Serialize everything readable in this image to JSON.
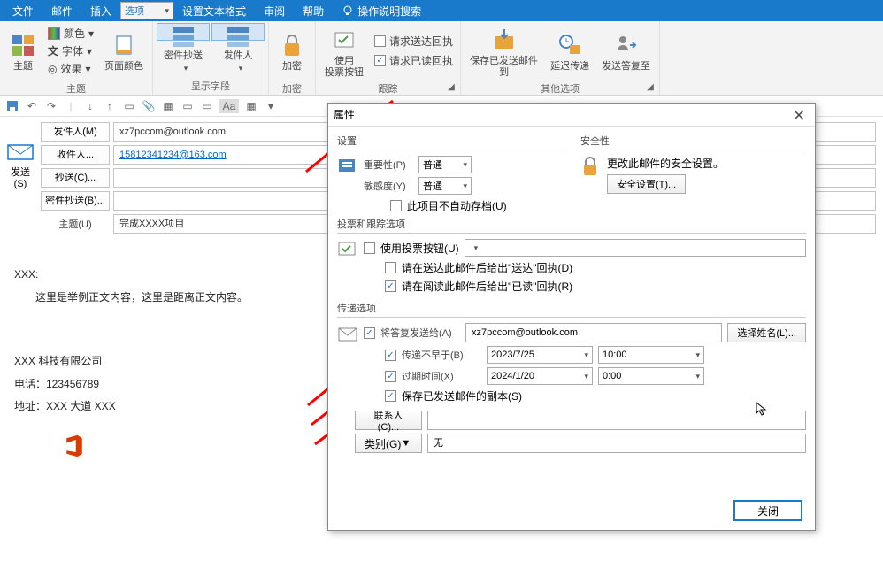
{
  "tabs": [
    "文件",
    "邮件",
    "插入",
    "选项",
    "设置文本格式",
    "审阅",
    "帮助"
  ],
  "tell_me": "操作说明搜索",
  "ribbon": {
    "theme_group": {
      "theme": "主题",
      "color": "颜色",
      "font": "字体",
      "effects": "效果",
      "page_color": "页面颜色",
      "label": "主题"
    },
    "show_group": {
      "bcc": "密件抄送",
      "from": "发件人",
      "label": "显示字段"
    },
    "encrypt_group": {
      "encrypt": "加密",
      "label": "加密"
    },
    "vote_group": {
      "button": "使用\n投票按钮",
      "req_delivery": "请求送达回执",
      "req_read": "请求已读回执",
      "label": "跟踪"
    },
    "more_group": {
      "save_sent": "保存已发送邮件\n到",
      "delay": "延迟传递",
      "direct_reply": "发送答复至",
      "label": "其他选项"
    }
  },
  "compose": {
    "send": "发送\n(S)",
    "from_btn": "发件人(M)",
    "from_val": "xz7pccom@outlook.com",
    "to_btn": "收件人...",
    "to_val": "15812341234@163.com",
    "cc_btn": "抄送(C)...",
    "cc_val": "",
    "bcc_btn": "密件抄送(B)...",
    "bcc_val": "",
    "subj_lbl": "主题(U)",
    "subj_val": "完成XXXX项目"
  },
  "body": {
    "greet": "XXX:",
    "para": "这里是举例正文内容，这里是距离正文内容。",
    "sig1": "XXX 科技有限公司",
    "sig2": "电话：123456789",
    "sig3": "地址：XXX 大道 XXX"
  },
  "dialog": {
    "title": "属性",
    "settings_hd": "设置",
    "security_hd": "安全性",
    "importance_lbl": "重要性(P)",
    "importance_val": "普通",
    "sensitivity_lbl": "敏感度(Y)",
    "sensitivity_val": "普通",
    "no_autoarchive": "此项目不自动存档(U)",
    "sec_text": "更改此邮件的安全设置。",
    "sec_btn": "安全设置(T)...",
    "vote_hd": "投票和跟踪选项",
    "use_vote": "使用投票按钮(U)",
    "req_delivery": "请在送达此邮件后给出\"送达\"回执(D)",
    "req_read": "请在阅读此邮件后给出\"已读\"回执(R)",
    "delivery_hd": "传递选项",
    "reply_to": "将答复发送给(A)",
    "reply_val": "xz7pccom@outlook.com",
    "select_names": "选择姓名(L)...",
    "not_before": "传递不早于(B)",
    "nb_date": "2023/7/25",
    "nb_time": "10:00",
    "expires": "过期时间(X)",
    "ex_date": "2024/1/20",
    "ex_time": "0:00",
    "save_copy": "保存已发送邮件的副本(S)",
    "contacts": "联系人(C)...",
    "category": "类别(G)",
    "category_val": "无",
    "close": "关闭"
  }
}
